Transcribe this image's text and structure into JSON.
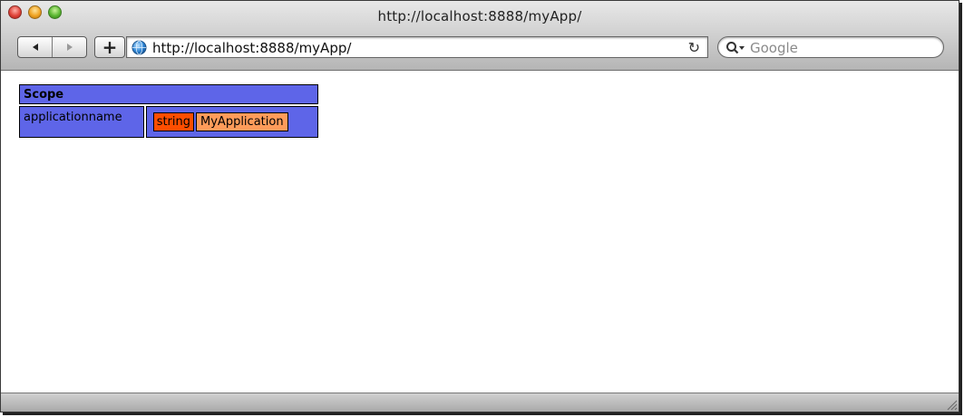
{
  "window": {
    "title": "http://localhost:8888/myApp/"
  },
  "toolbar": {
    "url": "http://localhost:8888/myApp/",
    "search_placeholder": "Google",
    "add_label": "+"
  },
  "dump": {
    "header": "Scope",
    "rows": [
      {
        "key": "applicationname",
        "type": "string",
        "value": "MyApplication"
      }
    ]
  },
  "colors": {
    "dump_struct": "#5e65e8",
    "dump_type": "#ff4e00",
    "dump_value": "#ff9c5a"
  },
  "icons": [
    "back-arrow-icon",
    "forward-arrow-icon",
    "globe-icon",
    "reload-icon",
    "search-icon",
    "resize-grip-icon"
  ]
}
